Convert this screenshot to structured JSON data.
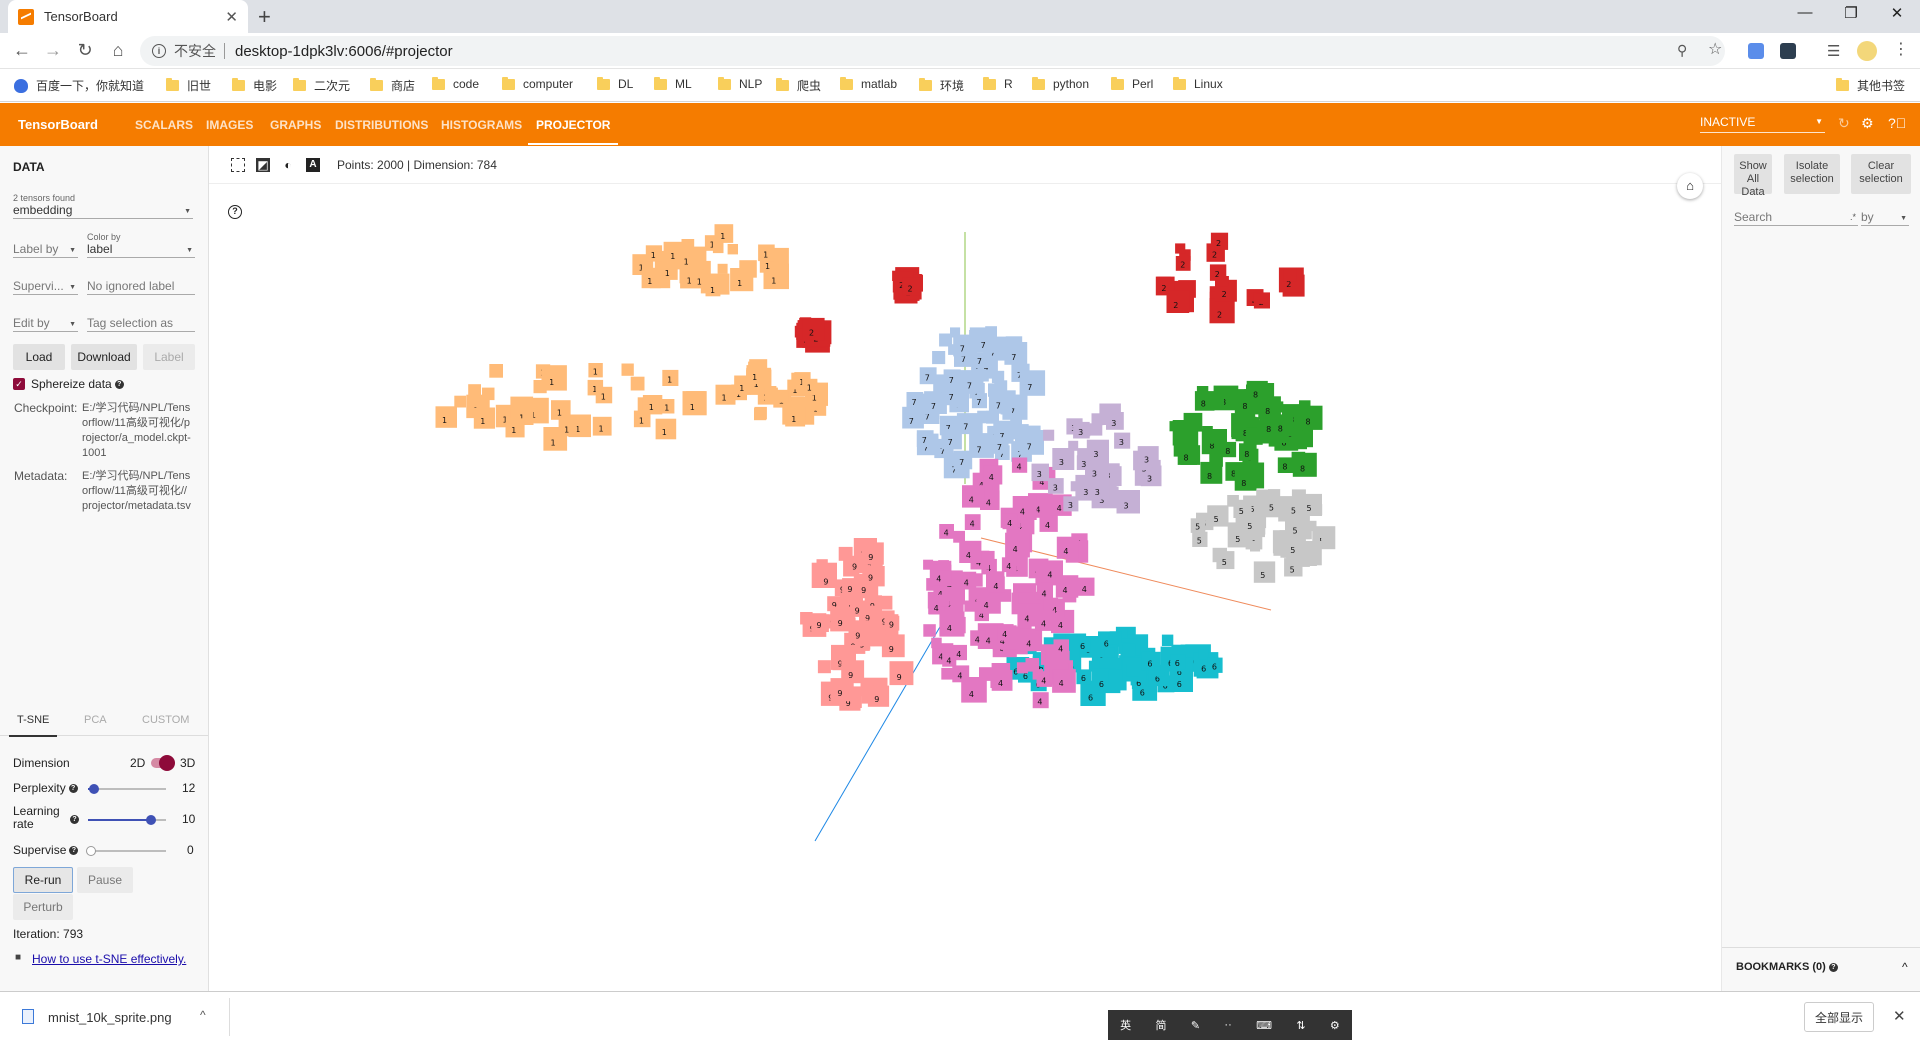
{
  "browser": {
    "tab_title": "TensorBoard",
    "insecure_label": "不安全",
    "url": "desktop-1dpk3lv:6006/#projector",
    "bookmarks": [
      "百度一下，你就知道",
      "旧世",
      "电影",
      "二次元",
      "商店",
      "code",
      "computer",
      "DL",
      "ML",
      "NLP",
      "爬虫",
      "matlab",
      "环境",
      "R",
      "python",
      "Perl",
      "Linux"
    ],
    "other_bookmarks": "其他书签"
  },
  "app": {
    "brand": "TensorBoard",
    "nav": [
      "SCALARS",
      "IMAGES",
      "GRAPHS",
      "DISTRIBUTIONS",
      "HISTOGRAMS",
      "PROJECTOR"
    ],
    "active_nav": "PROJECTOR",
    "run_selector": "INACTIVE",
    "accent_color": "#f57c00"
  },
  "data_panel": {
    "title": "DATA",
    "tensors_found": "2 tensors found",
    "tensor": "embedding",
    "label_by": "Label by",
    "color_by_label": "Color by",
    "color_by_value": "label",
    "supervise": "Supervi...",
    "ignored_placeholder": "No ignored label",
    "edit_by": "Edit by",
    "tag_placeholder": "Tag selection as",
    "buttons": {
      "load": "Load",
      "download": "Download",
      "label": "Label"
    },
    "sphereize": "Sphereize data",
    "checkpoint_label": "Checkpoint:",
    "checkpoint_path": "E:/学习代码/NPL/Tensorflow/11高级可视化/projector/a_model.ckpt-1001",
    "metadata_label": "Metadata:",
    "metadata_path": "E:/学习代码/NPL/Tensorflow/11高级可视化//projector/metadata.tsv"
  },
  "projection": {
    "tabs": [
      "T-SNE",
      "PCA",
      "CUSTOM"
    ],
    "active_tab": "T-SNE",
    "dimension_label": "Dimension",
    "dim_2d": "2D",
    "dim_3d": "3D",
    "perplexity_label": "Perplexity",
    "perplexity": "12",
    "learning_rate_label": "Learning rate",
    "learning_rate": "10",
    "supervise_label": "Supervise",
    "supervise": "0",
    "buttons": {
      "rerun": "Re-run",
      "pause": "Pause",
      "perturb": "Perturb"
    },
    "iteration": "Iteration: 793",
    "link": "How to use t-SNE effectively."
  },
  "stats": "Points: 2000 | Dimension: 784",
  "right_panel": {
    "show_all": "Show All Data",
    "isolate": "Isolate selection",
    "clear": "Clear selection",
    "search_placeholder": "Search",
    "by": "by",
    "bookmarks": "BOOKMARKS (0)"
  },
  "download_bar": {
    "file": "mnist_10k_sprite.png",
    "show_all": "全部显示"
  },
  "ime": [
    "英",
    "简"
  ],
  "digit_colors": {
    "0": "#cccccc",
    "1": "#ffbb78",
    "2": "#d62728",
    "4": "#e377c2",
    "5": "#c7c7c7",
    "6": "#17becf",
    "7": "#aec7e8",
    "8": "#2ca02c",
    "9": "#ff9896",
    "3": "#c5b0d5"
  },
  "clusters": [
    {
      "digit": "1",
      "count": 95
    },
    {
      "digit": "2",
      "count": 70
    },
    {
      "digit": "7",
      "count": 70
    },
    {
      "digit": "8",
      "count": 60
    },
    {
      "digit": "5",
      "count": 45
    },
    {
      "digit": "6",
      "count": 70
    },
    {
      "digit": "4",
      "count": 110
    },
    {
      "digit": "9",
      "count": 55
    },
    {
      "digit": "3",
      "count": 35
    }
  ]
}
